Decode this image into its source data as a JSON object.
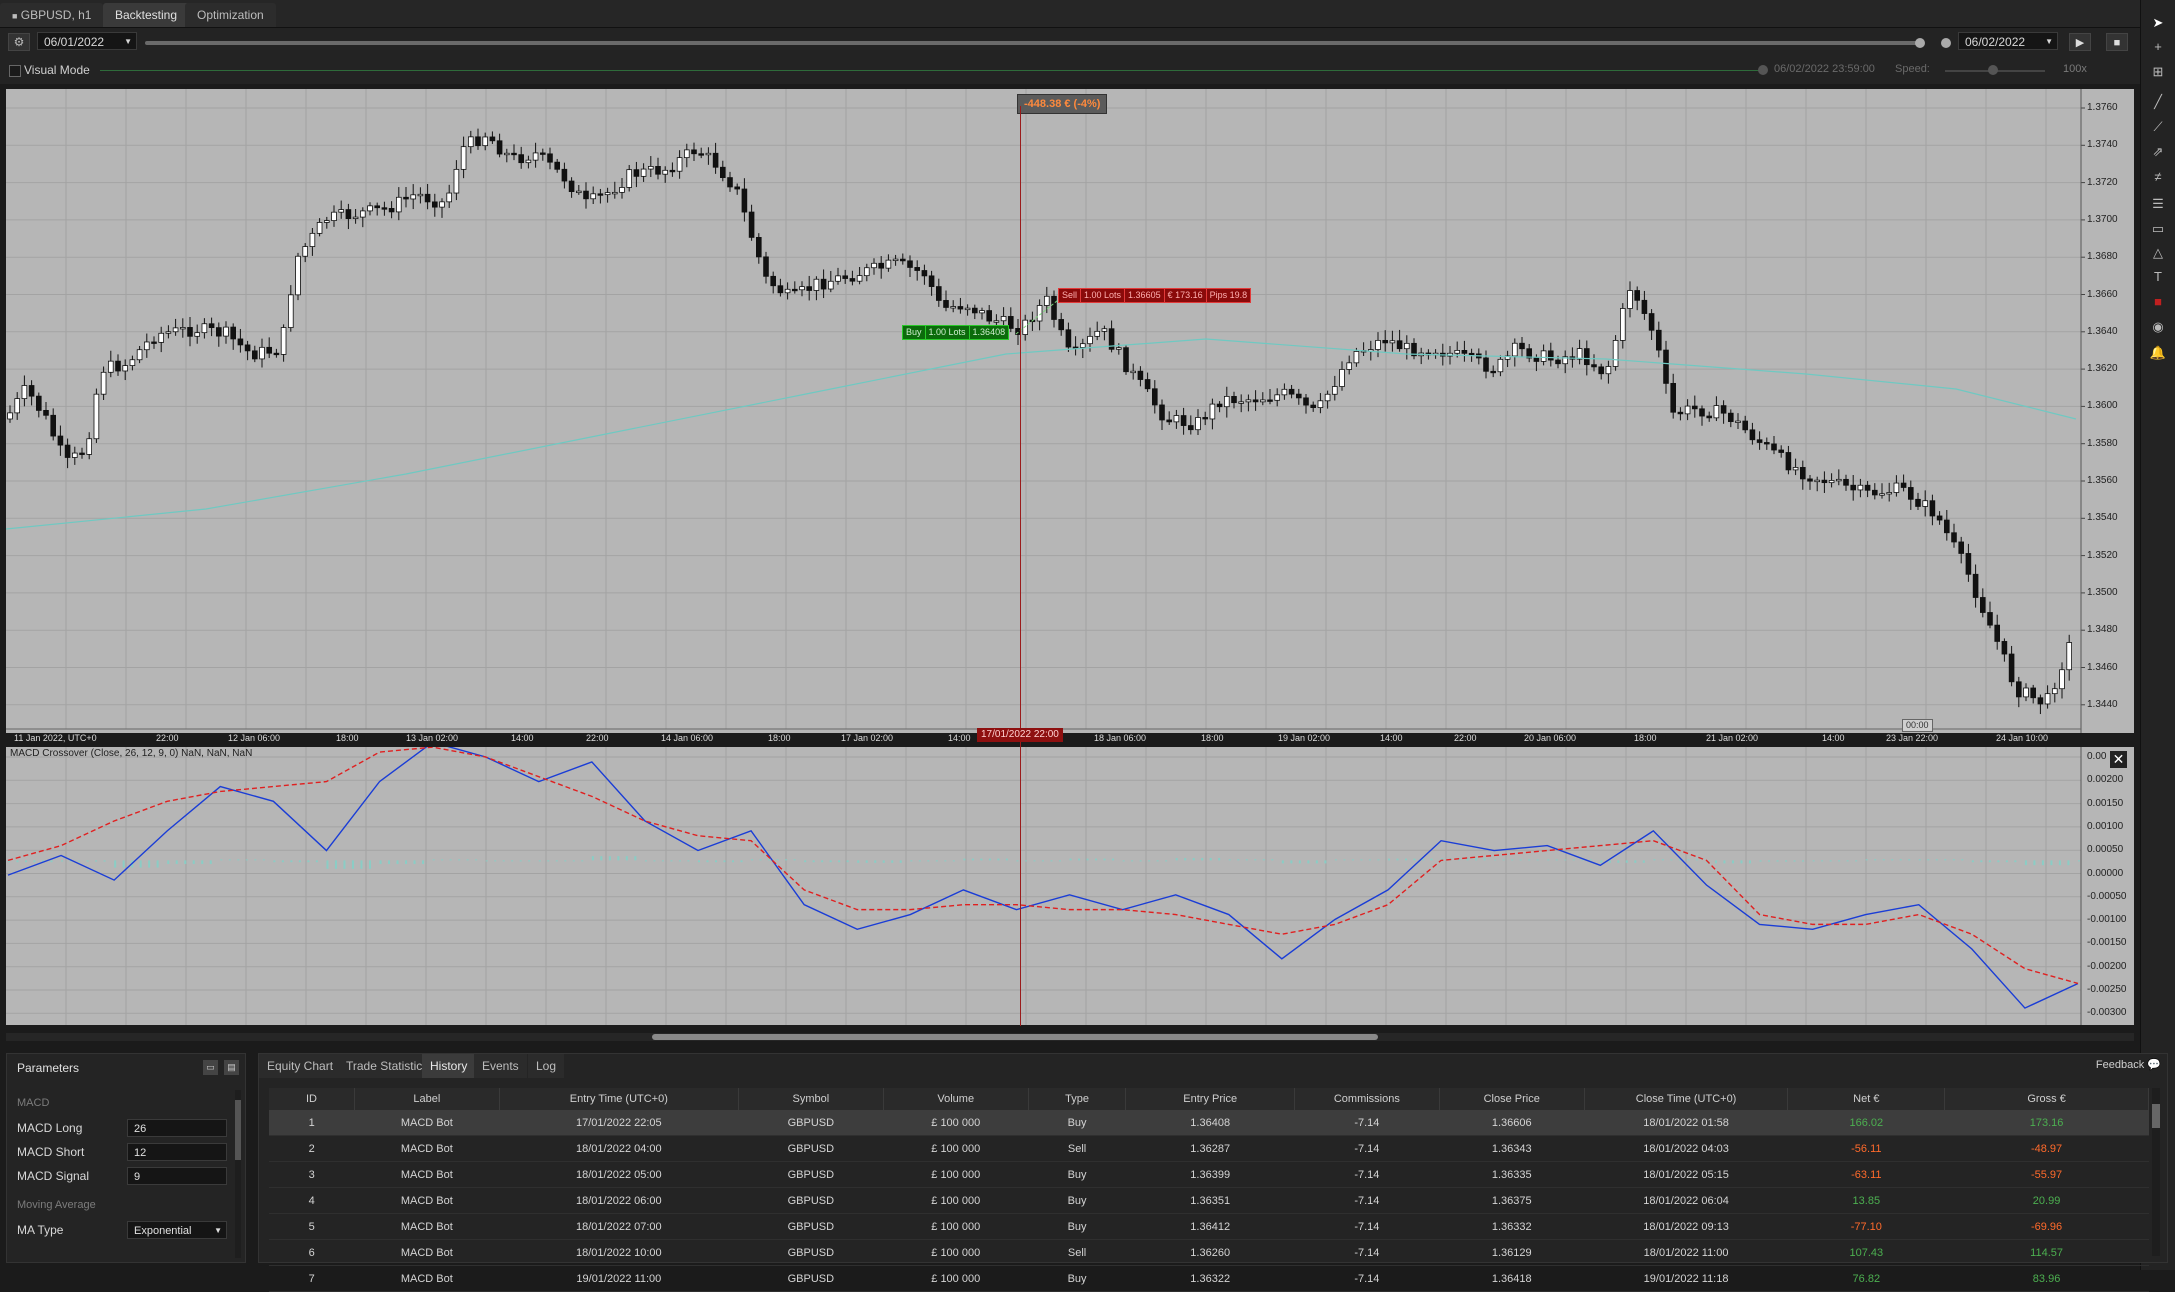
{
  "tabs": {
    "symbol_tab": "GBPUSD, h1",
    "backtesting": "Backtesting",
    "optimization": "Optimization"
  },
  "controls": {
    "start_date": "06/01/2022",
    "end_date": "06/02/2022",
    "visual_mode_label": "Visual Mode",
    "progress_time": "06/02/2022 23:59:00",
    "speed_label": "Speed:",
    "speed_value": "100x"
  },
  "chart": {
    "balance_flag": "-448.38 € (-4%)",
    "buy_label": "Buy",
    "buy_lots": "1.00 Lots",
    "buy_price": "1.36408",
    "sell_label": "Sell",
    "sell_lots": "1.00 Lots",
    "sell_price": "1.36605",
    "sell_net": "€ 173.16",
    "sell_pips": "Pips 19.8",
    "cursor_time": "17/01/2022 22:00",
    "timer": "00:00",
    "price_ticks": [
      "1.3760",
      "1.3740",
      "1.3720",
      "1.3700",
      "1.3680",
      "1.3660",
      "1.3640",
      "1.3620",
      "1.3600",
      "1.3580",
      "1.3560",
      "1.3540",
      "1.3520",
      "1.3500",
      "1.3480",
      "1.3460",
      "1.3440"
    ],
    "time_ticks": [
      "11 Jan 2022, UTC+0",
      "22:00",
      "12 Jan 06:00",
      "18:00",
      "13 Jan 02:00",
      "14:00",
      "22:00",
      "14 Jan 06:00",
      "18:00",
      "17 Jan 02:00",
      "14:00",
      "18 Jan 06:00",
      "18:00",
      "19 Jan 02:00",
      "14:00",
      "22:00",
      "20 Jan 06:00",
      "18:00",
      "21 Jan 02:00",
      "14:00",
      "23 Jan 22:00",
      "24 Jan 10:00"
    ],
    "macd_title": "MACD Crossover (Close, 26, 12, 9, 0) NaN, NaN, NaN",
    "macd_ticks": [
      "0.00",
      "0.00200",
      "0.00150",
      "0.00100",
      "0.00050",
      "0.00000",
      "-0.00050",
      "-0.00100",
      "-0.00150",
      "-0.00200",
      "-0.00250",
      "-0.00300"
    ]
  },
  "chart_data": {
    "type": "line",
    "title": "MACD Crossover (Close, 26, 12, 9, 0) NaN, NaN, NaN",
    "ylim": [
      -0.0031,
      0.0021
    ],
    "series": [
      {
        "values": [
          -0.0003,
          0.0001,
          -0.0004,
          0.0006,
          0.0015,
          0.0012,
          0.0002,
          0.0016,
          0.0024,
          0.0021,
          0.0016,
          0.002,
          0.0008,
          0.0002,
          0.0006,
          -0.0009,
          -0.0014,
          -0.0011,
          -0.0006,
          -0.001,
          -0.0007,
          -0.001,
          -0.0007,
          -0.0011,
          -0.002,
          -0.0012,
          -0.0006,
          0.0004,
          0.0002,
          0.0003,
          -0.0001,
          0.0006,
          -0.0005,
          -0.0013,
          -0.0014,
          -0.0011,
          -0.0009,
          -0.0018,
          -0.003,
          -0.0025
        ]
      },
      {
        "values": [
          0.0,
          0.0003,
          0.0008,
          0.0012,
          0.0014,
          0.0015,
          0.0016,
          0.0022,
          0.0023,
          0.0021,
          0.0017,
          0.0013,
          0.0008,
          0.0005,
          0.0004,
          -0.0006,
          -0.001,
          -0.001,
          -0.0009,
          -0.0009,
          -0.001,
          -0.001,
          -0.0011,
          -0.0013,
          -0.0015,
          -0.0013,
          -0.0009,
          0.0,
          0.0001,
          0.0002,
          0.0003,
          0.0004,
          0.0,
          -0.0011,
          -0.0013,
          -0.0013,
          -0.0011,
          -0.0015,
          -0.0022,
          -0.0025
        ]
      }
    ]
  },
  "params": {
    "title": "Parameters",
    "group_macd": "MACD",
    "macd_long_label": "MACD Long",
    "macd_long": "26",
    "macd_short_label": "MACD Short",
    "macd_short": "12",
    "macd_signal_label": "MACD Signal",
    "macd_signal": "9",
    "group_ma": "Moving Average",
    "ma_type_label": "MA Type",
    "ma_type": "Exponential"
  },
  "panel": {
    "tabs": [
      "Equity Chart",
      "Trade Statistics",
      "History",
      "Events",
      "Log"
    ],
    "feedback": "Feedback"
  },
  "history": {
    "columns": [
      "ID",
      "Label",
      "Entry Time (UTC+0)",
      "Symbol",
      "Volume",
      "Type",
      "Entry Price",
      "Commissions",
      "Close Price",
      "Close Time (UTC+0)",
      "Net €",
      "Gross €"
    ],
    "rows": [
      [
        "1",
        "MACD Bot",
        "17/01/2022 22:05",
        "GBPUSD",
        "£ 100 000",
        "Buy",
        "1.36408",
        "-7.14",
        "1.36606",
        "18/01/2022 01:58",
        "166.02",
        "173.16"
      ],
      [
        "2",
        "MACD Bot",
        "18/01/2022 04:00",
        "GBPUSD",
        "£ 100 000",
        "Sell",
        "1.36287",
        "-7.14",
        "1.36343",
        "18/01/2022 04:03",
        "-56.11",
        "-48.97"
      ],
      [
        "3",
        "MACD Bot",
        "18/01/2022 05:00",
        "GBPUSD",
        "£ 100 000",
        "Buy",
        "1.36399",
        "-7.14",
        "1.36335",
        "18/01/2022 05:15",
        "-63.11",
        "-55.97"
      ],
      [
        "4",
        "MACD Bot",
        "18/01/2022 06:00",
        "GBPUSD",
        "£ 100 000",
        "Buy",
        "1.36351",
        "-7.14",
        "1.36375",
        "18/01/2022 06:04",
        "13.85",
        "20.99"
      ],
      [
        "5",
        "MACD Bot",
        "18/01/2022 07:00",
        "GBPUSD",
        "£ 100 000",
        "Buy",
        "1.36412",
        "-7.14",
        "1.36332",
        "18/01/2022 09:13",
        "-77.10",
        "-69.96"
      ],
      [
        "6",
        "MACD Bot",
        "18/01/2022 10:00",
        "GBPUSD",
        "£ 100 000",
        "Sell",
        "1.36260",
        "-7.14",
        "1.36129",
        "18/01/2022 11:00",
        "107.43",
        "114.57"
      ],
      [
        "7",
        "MACD Bot",
        "19/01/2022 11:00",
        "GBPUSD",
        "£ 100 000",
        "Buy",
        "1.36322",
        "-7.14",
        "1.36418",
        "19/01/2022 11:18",
        "76.82",
        "83.96"
      ]
    ]
  }
}
